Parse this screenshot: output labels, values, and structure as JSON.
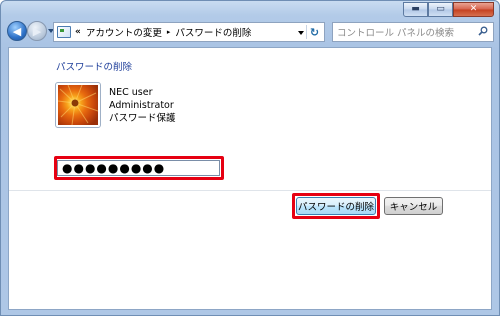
{
  "window": {
    "caption_buttons": {
      "minimize": "▬",
      "maximize": "▭",
      "close": "✕"
    }
  },
  "nav": {
    "back_glyph": "◀",
    "forward_glyph": "▶",
    "address": {
      "overflow": "«",
      "crumbs": [
        "アカウントの変更",
        "パスワードの削除"
      ],
      "separator": "▸",
      "refresh_glyph": "↻"
    },
    "search": {
      "placeholder": "コントロール パネルの検索"
    }
  },
  "main": {
    "heading": "パスワードの削除",
    "user": {
      "name": "NEC user",
      "role": "Administrator",
      "status": "パスワード保護"
    },
    "password": {
      "value": "●●●●●●●●●"
    },
    "buttons": {
      "remove_label": "パスワードの削除",
      "cancel_label": "キャンセル"
    },
    "highlight_color": "#e60012"
  }
}
